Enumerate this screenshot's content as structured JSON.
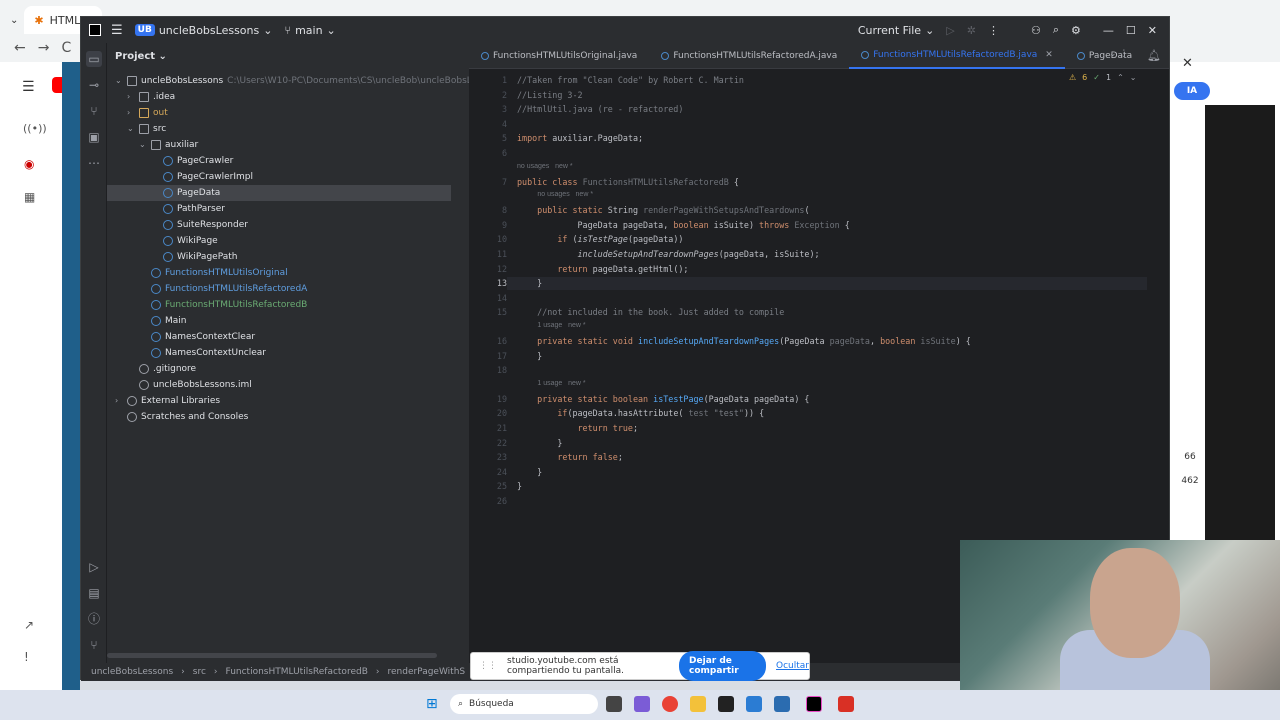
{
  "browser": {
    "tab_title": "HTML U",
    "nav_back": "←",
    "nav_forward": "→",
    "nav_reload": "C"
  },
  "ide": {
    "project_badge": "UB",
    "project_name": "uncleBobsLessons",
    "branch": "main",
    "run_config": "Current File",
    "project_panel_title": "Project",
    "tree": [
      {
        "label": "uncleBobsLessons",
        "extra": "C:\\Users\\W10-PC\\Documents\\CS\\uncleBob\\uncleBobsLes",
        "indent": 0,
        "kind": "folder",
        "arrow": "⌄"
      },
      {
        "label": ".idea",
        "indent": 1,
        "kind": "folder",
        "arrow": "›"
      },
      {
        "label": "out",
        "indent": 1,
        "kind": "folder-orange",
        "arrow": "›"
      },
      {
        "label": "src",
        "indent": 1,
        "kind": "folder",
        "arrow": "⌄"
      },
      {
        "label": "auxiliar",
        "indent": 2,
        "kind": "folder",
        "arrow": "⌄"
      },
      {
        "label": "PageCrawler",
        "indent": 3,
        "kind": "class"
      },
      {
        "label": "PageCrawlerImpl",
        "indent": 3,
        "kind": "class"
      },
      {
        "label": "PageData",
        "indent": 3,
        "kind": "class",
        "selected": true
      },
      {
        "label": "PathParser",
        "indent": 3,
        "kind": "class"
      },
      {
        "label": "SuiteResponder",
        "indent": 3,
        "kind": "class"
      },
      {
        "label": "WikiPage",
        "indent": 3,
        "kind": "class"
      },
      {
        "label": "WikiPagePath",
        "indent": 3,
        "kind": "class"
      },
      {
        "label": "FunctionsHTMLUtilsOriginal",
        "indent": 2,
        "kind": "class-blue"
      },
      {
        "label": "FunctionsHTMLUtilsRefactoredA",
        "indent": 2,
        "kind": "class-blue"
      },
      {
        "label": "FunctionsHTMLUtilsRefactoredB",
        "indent": 2,
        "kind": "class-green"
      },
      {
        "label": "Main",
        "indent": 2,
        "kind": "class"
      },
      {
        "label": "NamesContextClear",
        "indent": 2,
        "kind": "class"
      },
      {
        "label": "NamesContextUnclear",
        "indent": 2,
        "kind": "class"
      },
      {
        "label": ".gitignore",
        "indent": 1,
        "kind": "file"
      },
      {
        "label": "uncleBobsLessons.iml",
        "indent": 1,
        "kind": "file"
      },
      {
        "label": "External Libraries",
        "indent": 0,
        "kind": "lib",
        "arrow": "›"
      },
      {
        "label": "Scratches and Consoles",
        "indent": 0,
        "kind": "scratch"
      }
    ],
    "tabs": [
      {
        "label": "FunctionsHTMLUtilsOriginal.java",
        "active": false
      },
      {
        "label": "FunctionsHTMLUtilsRefactoredA.java",
        "active": false
      },
      {
        "label": "FunctionsHTMLUtilsRefactoredB.java",
        "active": true
      },
      {
        "label": "PageData",
        "active": false
      }
    ],
    "inspections": {
      "warnings": "6",
      "ok": "1"
    },
    "code_lines": [
      {
        "n": "1",
        "html": "<span class='cm'>//Taken from \"Clean Code\" by Robert C. Martin</span>"
      },
      {
        "n": "2",
        "html": "<span class='cm'>//Listing 3-2</span>"
      },
      {
        "n": "3",
        "html": "<span class='cm'>//HtmlUtil.java (re - refactored)</span>"
      },
      {
        "n": "4",
        "html": ""
      },
      {
        "n": "5",
        "html": "<span class='kw'>import</span> auxiliar.PageData;"
      },
      {
        "n": "6",
        "html": ""
      },
      {
        "n": "7",
        "html": "<span class='kw'>public class</span> <span class='gr'>FunctionsHTMLUtilsRefactoredB</span> {",
        "hint": "no usages   new *"
      },
      {
        "n": "8",
        "html": "    <span class='kw'>public static</span> String <span class='gr'>renderPageWithSetupsAndTeardowns</span>(",
        "hint": "no usages   new *"
      },
      {
        "n": "9",
        "html": "            PageData pageData, <span class='kw'>boolean</span> isSuite) <span class='kw'>throws</span> <span class='gr'>Exception</span> {"
      },
      {
        "n": "10",
        "html": "        <span class='kw'>if</span> (<span class='it'>isTestPage</span>(pageData))"
      },
      {
        "n": "11",
        "html": "            <span class='it'>includeSetupAndTeardownPages</span>(pageData, isSuite);"
      },
      {
        "n": "12",
        "html": "        <span class='kw'>return</span> pageData.getHtml();"
      },
      {
        "n": "13",
        "html": "    }",
        "current": true
      },
      {
        "n": "14",
        "html": ""
      },
      {
        "n": "15",
        "html": "    <span class='cm'>//not included in the book. Just added to compile</span>"
      },
      {
        "n": "16",
        "html": "    <span class='kw'>private static void</span> <span class='fn'>includeSetupAndTeardownPages</span>(PageData <span class='gr'>pageData</span>, <span class='kw'>boolean</span> <span class='gr'>isSuite</span>) {",
        "hint": "1 usage   new *"
      },
      {
        "n": "17",
        "html": "    }"
      },
      {
        "n": "18",
        "html": ""
      },
      {
        "n": "19",
        "html": "    <span class='kw'>private static boolean</span> <span class='fn'>isTestPage</span>(PageData pageData) {",
        "hint": "1 usage   new *"
      },
      {
        "n": "20",
        "html": "        <span class='kw'>if</span>(pageData.hasAttribute( <span class='gr'>test</span> <span class='cm'>\"test\"</span>)) {"
      },
      {
        "n": "21",
        "html": "            <span class='kw'>return true</span>;"
      },
      {
        "n": "22",
        "html": "        }"
      },
      {
        "n": "23",
        "html": "        <span class='kw'>return false</span>;"
      },
      {
        "n": "24",
        "html": "    }"
      },
      {
        "n": "25",
        "html": "}"
      },
      {
        "n": "26",
        "html": ""
      }
    ],
    "breadcrumb": [
      "uncleBobsLessons",
      "src",
      "FunctionsHTMLUtilsRefactoredB",
      "renderPageWithS"
    ]
  },
  "share_bar": {
    "message": "studio.youtube.com está compartiendo tu pantalla.",
    "stop_label": "Dejar de compartir",
    "hide_label": "Ocultar"
  },
  "taskbar": {
    "search_placeholder": "Búsqueda"
  },
  "side_counters": {
    "top": "66",
    "bottom": "462"
  },
  "ia_badge": "IA"
}
